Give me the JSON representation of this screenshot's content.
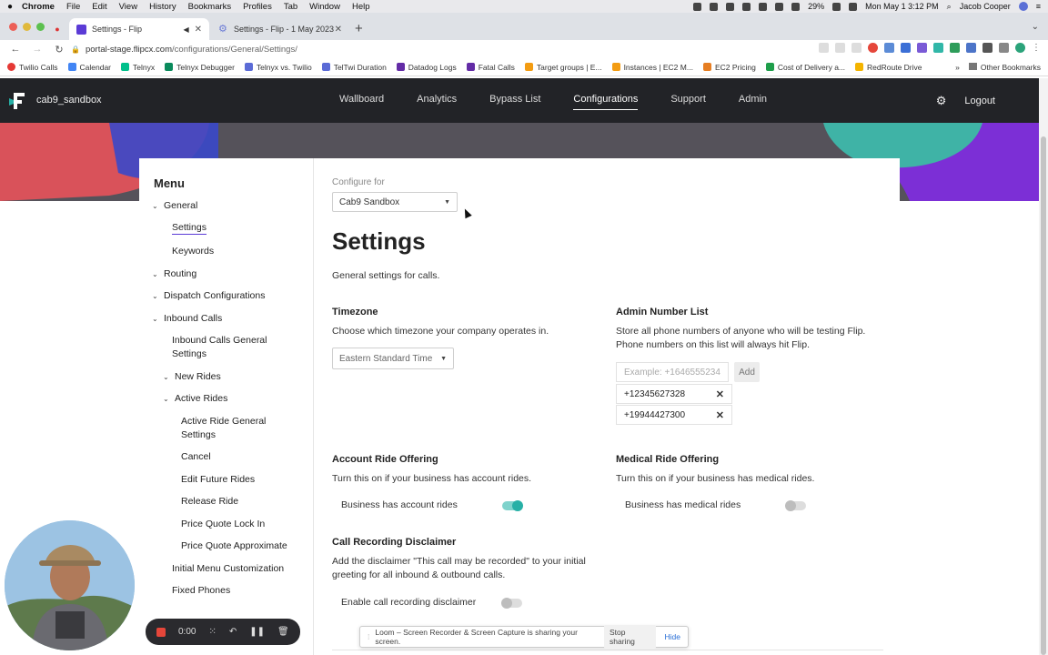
{
  "menubar": {
    "app": "Chrome",
    "items": [
      "File",
      "Edit",
      "View",
      "History",
      "Bookmarks",
      "Profiles",
      "Tab",
      "Window",
      "Help"
    ],
    "battery": "29%",
    "datetime": "Mon May 1  3:12 PM",
    "user": "Jacob Cooper"
  },
  "tabs": [
    {
      "title": "Settings - Flip"
    },
    {
      "title": "Settings - Flip - 1 May 2023"
    }
  ],
  "address": {
    "host": "portal-stage.flipcx.com",
    "path": "/configurations/General/Settings/"
  },
  "bookmarks": {
    "items": [
      "Twilio Calls",
      "Calendar",
      "Telnyx",
      "Telnyx Debugger",
      "Telnyx vs. Twilio",
      "TelTwi Duration",
      "Datadog Logs",
      "Fatal Calls",
      "Target groups | E...",
      "Instances | EC2 M...",
      "EC2 Pricing",
      "Cost of Delivery a...",
      "RedRoute Drive"
    ],
    "more": "»",
    "other": "Other Bookmarks"
  },
  "appnav": {
    "workspace": "cab9_sandbox",
    "links": [
      "Wallboard",
      "Analytics",
      "Bypass List",
      "Configurations",
      "Support",
      "Admin"
    ],
    "logout": "Logout"
  },
  "menu": {
    "title": "Menu",
    "general": "General",
    "settings": "Settings",
    "keywords": "Keywords",
    "routing": "Routing",
    "dispatch": "Dispatch Configurations",
    "inbound": "Inbound Calls",
    "inbound_general_1": "Inbound Calls General",
    "inbound_general_2": "Settings",
    "new_rides": "New Rides",
    "active_rides": "Active Rides",
    "active_general_1": "Active Ride General",
    "active_general_2": "Settings",
    "cancel": "Cancel",
    "edit_future": "Edit Future Rides",
    "release": "Release Ride",
    "lock_in": "Price Quote Lock In",
    "approx": "Price Quote Approximate",
    "initial_menu": "Initial Menu Customization",
    "fixed_phones": "Fixed Phones"
  },
  "main": {
    "configure_label": "Configure for",
    "configure_value": "Cab9 Sandbox",
    "title": "Settings",
    "description": "General settings for calls.",
    "timezone": {
      "heading": "Timezone",
      "desc": "Choose which timezone your company operates in.",
      "value": "Eastern Standard Time"
    },
    "admin": {
      "heading": "Admin Number List",
      "desc1": "Store all phone numbers of anyone who will be testing Flip.",
      "desc2": "Phone numbers on this list will always hit Flip.",
      "placeholder": "Example: +1646555234",
      "add": "Add",
      "numbers": [
        "+12345627328",
        "+19944427300"
      ]
    },
    "account": {
      "heading": "Account Ride Offering",
      "desc": "Turn this on if your business has account rides.",
      "toggle_label": "Business has account rides"
    },
    "medical": {
      "heading": "Medical Ride Offering",
      "desc": "Turn this on if your business has medical rides.",
      "toggle_label": "Business has medical rides"
    },
    "recording": {
      "heading": "Call Recording Disclaimer",
      "desc1": "Add the disclaimer \"This call may be recorded\" to your initial",
      "desc2": "greeting for all inbound & outbound calls.",
      "toggle_label": "Enable call recording disclaimer"
    }
  },
  "recorder": {
    "time": "0:00"
  },
  "sharebar": {
    "text": "Loom – Screen Recorder & Screen Capture is sharing your screen.",
    "stop": "Stop sharing",
    "hide": "Hide"
  },
  "colors": {
    "nav_bg": "#222327",
    "accent": "#5b3bd6",
    "toggle_on": "#27b0a6"
  }
}
